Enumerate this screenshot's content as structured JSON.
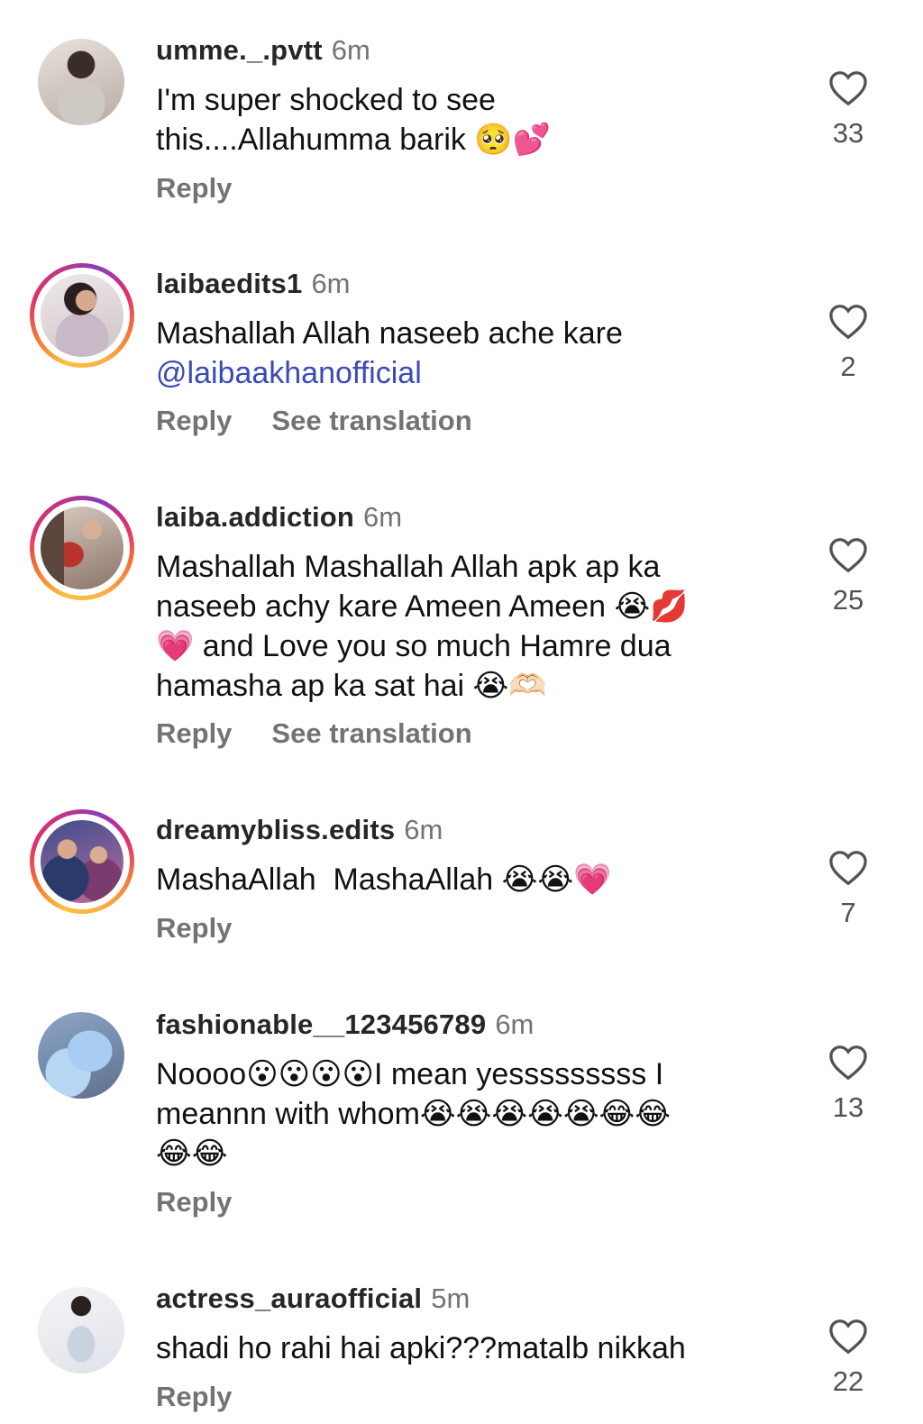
{
  "colors": {
    "username": "#262626",
    "meta": "#737373",
    "mention": "#3b4bb5",
    "ring_start": "#f9c23c",
    "ring_mid": "#e1306c",
    "ring_end": "#8a3ab9"
  },
  "labels": {
    "reply": "Reply",
    "see_translation": "See translation"
  },
  "comments": [
    {
      "username": "umme._.pvtt",
      "time": "6m",
      "text": "I'm super shocked to see\nthis....Allahumma barik 🥺💕",
      "likes": "33",
      "has_story_ring": false,
      "avatar_icon": "profile-photo"
    },
    {
      "username": "laibaedits1",
      "time": "6m",
      "text": "Mashallah Allah naseeb ache kare",
      "mention": "@laibaakhanofficial",
      "likes": "2",
      "has_story_ring": true,
      "avatar_icon": "profile-photo"
    },
    {
      "username": "laiba.addiction",
      "time": "6m",
      "text": "Mashallah Mashallah Allah apk ap ka\nnaseeb achy kare Ameen Ameen 😭💋\n💗 and Love you so much Hamre dua\nhamasha ap ka sat hai 😭🫶🏻",
      "likes": "25",
      "has_story_ring": true,
      "avatar_icon": "profile-photo"
    },
    {
      "username": "dreamybliss.edits",
      "time": "6m",
      "text": "MashaAllah  MashaAllah 😭😭💗",
      "likes": "7",
      "has_story_ring": true,
      "avatar_icon": "profile-photo"
    },
    {
      "username": "fashionable__123456789",
      "time": "6m",
      "text": "Noooo😮😮😮😮I mean yesssssssss I\nmeannn with whom😭😭😭😭😭😂😂\n😂😂",
      "likes": "13",
      "has_story_ring": false,
      "avatar_icon": "profile-photo"
    },
    {
      "username": "actress_auraofficial",
      "time": "5m",
      "text": "shadi ho rahi hai apki???matalb nikkah",
      "likes": "22",
      "has_story_ring": false,
      "avatar_icon": "profile-photo"
    }
  ]
}
